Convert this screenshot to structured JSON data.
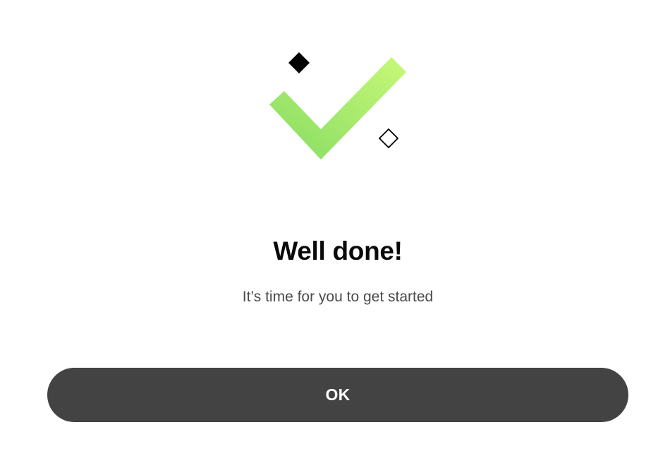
{
  "success": {
    "illustration_icon": "checkmark-icon",
    "accent_gradient": [
      "#86dc63",
      "#c8f878"
    ],
    "title": "Well done!",
    "subtitle": "It’s time for you to get started"
  },
  "actions": {
    "ok_label": "OK",
    "button_color": "#434343"
  }
}
